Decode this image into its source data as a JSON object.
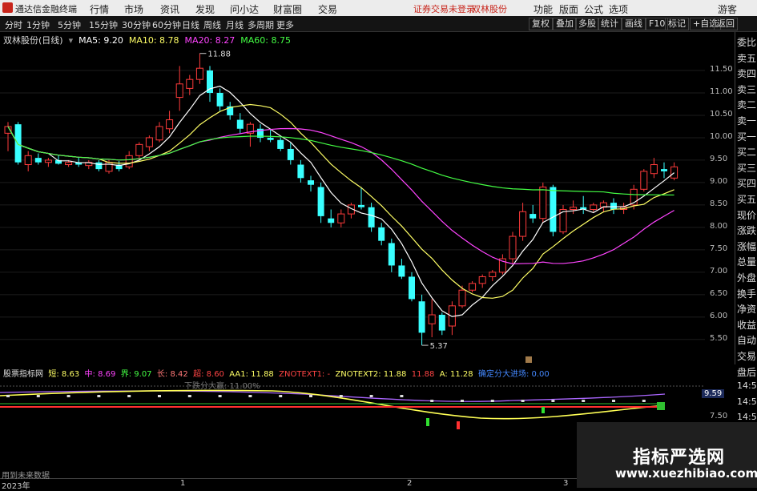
{
  "menubar": {
    "app_name": "通达信金融终端",
    "items": [
      "行情",
      "市场",
      "资讯",
      "发现",
      "问小达",
      "财富圈",
      "交易"
    ],
    "login_text": "证券交易未登录",
    "stock_link": "双林股份",
    "right_items": [
      "功能",
      "版面",
      "公式",
      "选项"
    ],
    "guest": "游客"
  },
  "toolbar": {
    "periods": [
      "分时",
      "1分钟",
      "5分钟",
      "15分钟",
      "30分钟",
      "60分钟",
      "日线",
      "周线",
      "月线",
      "多周期",
      "更多"
    ],
    "right_buttons": [
      "复权",
      "叠加",
      "多股",
      "统计",
      "画线",
      "F10",
      "标记",
      "+自选",
      "返回"
    ]
  },
  "main_info": {
    "stock_title": "双林股份(日线)",
    "ma5": "MA5: 9.20",
    "ma10": "MA10: 8.78",
    "ma20": "MA20: 8.27",
    "ma60": "MA60: 8.75"
  },
  "y_axis_labels": [
    "11.50",
    "11.00",
    "10.50",
    "10.00",
    "9.50",
    "9.00",
    "8.50",
    "8.00",
    "7.50",
    "7.00",
    "6.50",
    "6.00",
    "5.50"
  ],
  "price_annotations": {
    "high": "11.88",
    "low": "5.37"
  },
  "right_panel": [
    "委比",
    "卖五",
    "卖四",
    "卖三",
    "卖二",
    "卖一",
    "买一",
    "买二",
    "买三",
    "买四",
    "买五",
    "现价",
    "涨跌",
    "涨幅",
    "总量",
    "外盘",
    "换手",
    "净资",
    "收益",
    "自动",
    "交易",
    "盘后",
    "14:5",
    "14:5",
    "14:5",
    "14:5"
  ],
  "sub_info": {
    "name": "股票指标网",
    "short": "短: 8.63",
    "mid": "中: 8.69",
    "bound": "界: 9.07",
    "long": "长: 8.42",
    "super": "超: 8.60",
    "aa1": "AA1: 11.88",
    "zn1": "ZNOTEXT1: -",
    "zn2": "ZNOTEXT2: 11.88",
    "v": "11.88",
    "a": "A: 11.28",
    "extra": "确定分大进场: 0.00"
  },
  "sub_labels": {
    "overlay": "下跌分大赢: 11.00%",
    "value_box": "9.59",
    "y1": "7.50"
  },
  "time_axis": {
    "year": "2023年",
    "marks": [
      "1",
      "2",
      "3"
    ]
  },
  "footer_text": "用到未来数据",
  "watermark": {
    "title": "指标严选网",
    "url": "www.xuezhibiao.com"
  },
  "colors": {
    "up": "#ff3b3b",
    "down": "#39ffff",
    "ma5": "#ffffff",
    "ma10": "#ffff66",
    "ma20": "#ff44ff",
    "ma60": "#44ff44"
  },
  "chart_data": {
    "type": "candlestick",
    "y_range": [
      5.3,
      12.0
    ],
    "candles": [
      {
        "o": 10.1,
        "h": 10.35,
        "l": 9.7,
        "c": 10.25
      },
      {
        "o": 10.3,
        "h": 10.35,
        "l": 9.4,
        "c": 9.45
      },
      {
        "o": 9.4,
        "h": 9.7,
        "l": 9.25,
        "c": 9.6
      },
      {
        "o": 9.55,
        "h": 9.65,
        "l": 9.4,
        "c": 9.45
      },
      {
        "o": 9.45,
        "h": 9.55,
        "l": 9.35,
        "c": 9.5
      },
      {
        "o": 9.5,
        "h": 9.6,
        "l": 9.4,
        "c": 9.42
      },
      {
        "o": 9.4,
        "h": 9.5,
        "l": 9.35,
        "c": 9.45
      },
      {
        "o": 9.45,
        "h": 9.55,
        "l": 9.35,
        "c": 9.4
      },
      {
        "o": 9.38,
        "h": 9.5,
        "l": 9.3,
        "c": 9.45
      },
      {
        "o": 9.45,
        "h": 9.5,
        "l": 9.25,
        "c": 9.3
      },
      {
        "o": 9.25,
        "h": 9.5,
        "l": 9.2,
        "c": 9.45
      },
      {
        "o": 9.4,
        "h": 9.48,
        "l": 9.25,
        "c": 9.3
      },
      {
        "o": 9.35,
        "h": 9.7,
        "l": 9.3,
        "c": 9.6
      },
      {
        "o": 9.6,
        "h": 9.9,
        "l": 9.5,
        "c": 9.85
      },
      {
        "o": 9.8,
        "h": 10.05,
        "l": 9.7,
        "c": 10.0
      },
      {
        "o": 9.95,
        "h": 10.35,
        "l": 9.9,
        "c": 10.25
      },
      {
        "o": 10.2,
        "h": 10.6,
        "l": 10.1,
        "c": 10.4
      },
      {
        "o": 10.9,
        "h": 11.6,
        "l": 10.6,
        "c": 11.2
      },
      {
        "o": 11.1,
        "h": 11.4,
        "l": 10.95,
        "c": 11.3
      },
      {
        "o": 11.3,
        "h": 11.88,
        "l": 11.2,
        "c": 11.55
      },
      {
        "o": 11.5,
        "h": 11.6,
        "l": 10.8,
        "c": 11.0
      },
      {
        "o": 11.0,
        "h": 11.1,
        "l": 10.6,
        "c": 10.7
      },
      {
        "o": 10.7,
        "h": 10.8,
        "l": 10.4,
        "c": 10.5
      },
      {
        "o": 10.4,
        "h": 10.55,
        "l": 10.1,
        "c": 10.2
      },
      {
        "o": 10.1,
        "h": 10.35,
        "l": 9.8,
        "c": 10.3
      },
      {
        "o": 10.2,
        "h": 10.3,
        "l": 9.9,
        "c": 10.0
      },
      {
        "o": 10.0,
        "h": 10.2,
        "l": 9.9,
        "c": 9.95
      },
      {
        "o": 9.95,
        "h": 10.0,
        "l": 9.7,
        "c": 9.75
      },
      {
        "o": 9.75,
        "h": 9.9,
        "l": 9.4,
        "c": 9.5
      },
      {
        "o": 9.4,
        "h": 9.5,
        "l": 9.0,
        "c": 9.1
      },
      {
        "o": 9.05,
        "h": 9.15,
        "l": 8.8,
        "c": 8.95
      },
      {
        "o": 8.9,
        "h": 9.0,
        "l": 8.1,
        "c": 8.25
      },
      {
        "o": 8.2,
        "h": 8.4,
        "l": 8.0,
        "c": 8.1
      },
      {
        "o": 8.1,
        "h": 8.4,
        "l": 8.0,
        "c": 8.3
      },
      {
        "o": 8.3,
        "h": 8.55,
        "l": 8.2,
        "c": 8.5
      },
      {
        "o": 8.5,
        "h": 8.9,
        "l": 8.4,
        "c": 8.45
      },
      {
        "o": 8.45,
        "h": 8.55,
        "l": 7.9,
        "c": 8.0
      },
      {
        "o": 8.0,
        "h": 8.1,
        "l": 7.6,
        "c": 7.7
      },
      {
        "o": 7.65,
        "h": 7.75,
        "l": 7.0,
        "c": 7.15
      },
      {
        "o": 7.15,
        "h": 7.3,
        "l": 6.85,
        "c": 6.9
      },
      {
        "o": 6.9,
        "h": 7.0,
        "l": 6.35,
        "c": 6.4
      },
      {
        "o": 6.35,
        "h": 6.5,
        "l": 5.37,
        "c": 5.65
      },
      {
        "o": 5.85,
        "h": 6.4,
        "l": 5.55,
        "c": 6.05
      },
      {
        "o": 6.05,
        "h": 6.1,
        "l": 5.6,
        "c": 5.7
      },
      {
        "o": 5.8,
        "h": 6.35,
        "l": 5.6,
        "c": 6.25
      },
      {
        "o": 6.25,
        "h": 6.7,
        "l": 6.2,
        "c": 6.6
      },
      {
        "o": 6.6,
        "h": 6.8,
        "l": 6.55,
        "c": 6.75
      },
      {
        "o": 6.75,
        "h": 6.95,
        "l": 6.65,
        "c": 6.9
      },
      {
        "o": 6.9,
        "h": 7.05,
        "l": 6.8,
        "c": 7.0
      },
      {
        "o": 7.0,
        "h": 7.4,
        "l": 6.95,
        "c": 7.3
      },
      {
        "o": 7.3,
        "h": 7.9,
        "l": 7.2,
        "c": 7.8
      },
      {
        "o": 7.8,
        "h": 8.55,
        "l": 7.7,
        "c": 8.35
      },
      {
        "o": 8.3,
        "h": 8.5,
        "l": 8.1,
        "c": 8.2
      },
      {
        "o": 8.2,
        "h": 9.0,
        "l": 8.1,
        "c": 8.9
      },
      {
        "o": 8.9,
        "h": 8.95,
        "l": 7.8,
        "c": 7.9
      },
      {
        "o": 7.9,
        "h": 8.5,
        "l": 7.85,
        "c": 8.4
      },
      {
        "o": 8.4,
        "h": 8.6,
        "l": 8.3,
        "c": 8.45
      },
      {
        "o": 8.45,
        "h": 8.7,
        "l": 8.3,
        "c": 8.4
      },
      {
        "o": 8.4,
        "h": 8.55,
        "l": 8.35,
        "c": 8.5
      },
      {
        "o": 8.45,
        "h": 8.6,
        "l": 8.35,
        "c": 8.55
      },
      {
        "o": 8.55,
        "h": 8.65,
        "l": 8.3,
        "c": 8.4
      },
      {
        "o": 8.4,
        "h": 8.55,
        "l": 8.3,
        "c": 8.45
      },
      {
        "o": 8.5,
        "h": 8.95,
        "l": 8.4,
        "c": 8.85
      },
      {
        "o": 8.85,
        "h": 9.3,
        "l": 8.8,
        "c": 9.25
      },
      {
        "o": 9.2,
        "h": 9.55,
        "l": 9.1,
        "c": 9.4
      },
      {
        "o": 9.3,
        "h": 9.45,
        "l": 9.1,
        "c": 9.25
      },
      {
        "o": 9.1,
        "h": 9.45,
        "l": 9.05,
        "c": 9.35
      }
    ]
  }
}
